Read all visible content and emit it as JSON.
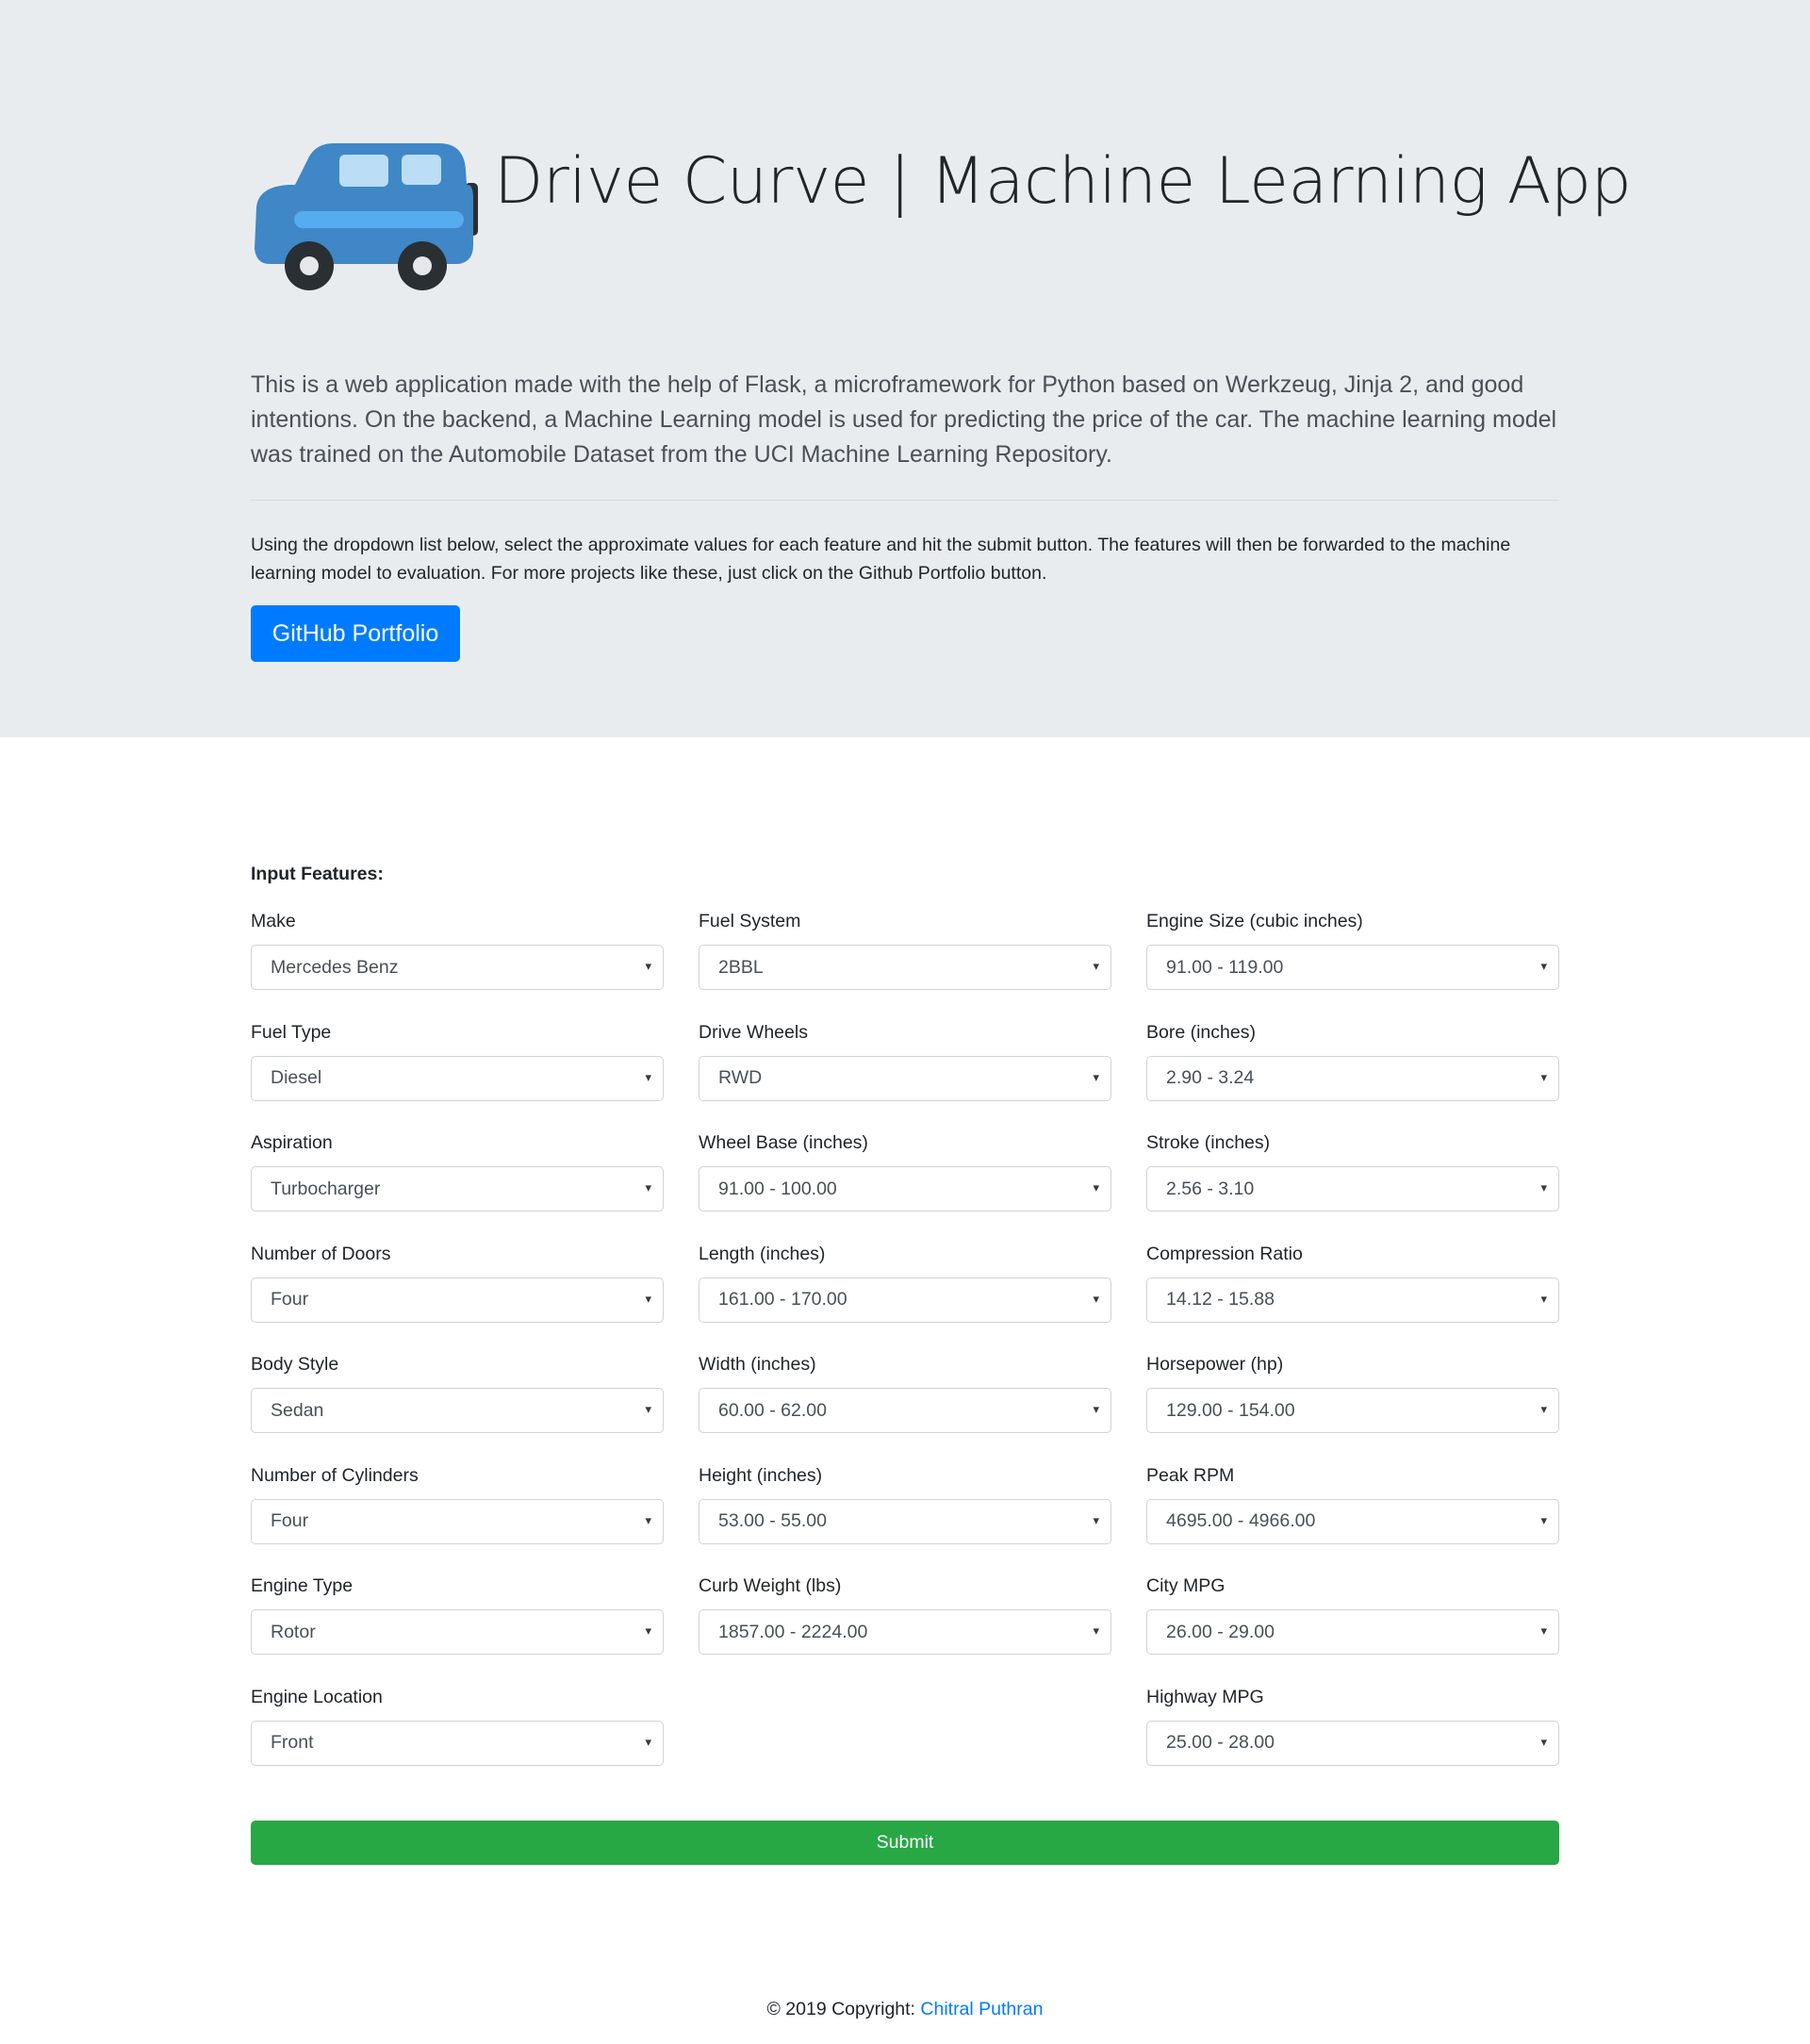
{
  "header": {
    "title": "Drive Curve | Machine Learning App",
    "logo_icon": "car-icon",
    "lead": "This is a web application made with the help of Flask, a microframework for Python based on Werkzeug, Jinja 2, and good intentions. On the backend, a Machine Learning model is used for predicting the price of the car. The machine learning model was trained on the Automobile Dataset from the UCI Machine Learning Repository.",
    "intro": "Using the dropdown list below, select the approximate values for each feature and hit the submit button. The features will then be forwarded to the machine learning model to evaluation. For more projects like these, just click on the Github Portfolio button.",
    "github_button": "GitHub Portfolio"
  },
  "form": {
    "heading": "Input Features:",
    "columns": [
      [
        {
          "label": "Make",
          "value": "Mercedes Benz"
        },
        {
          "label": "Fuel Type",
          "value": "Diesel"
        },
        {
          "label": "Aspiration",
          "value": "Turbocharger"
        },
        {
          "label": "Number of Doors",
          "value": "Four"
        },
        {
          "label": "Body Style",
          "value": "Sedan"
        },
        {
          "label": "Number of Cylinders",
          "value": "Four"
        },
        {
          "label": "Engine Type",
          "value": "Rotor"
        },
        {
          "label": "Engine Location",
          "value": "Front"
        }
      ],
      [
        {
          "label": "Fuel System",
          "value": "2BBL"
        },
        {
          "label": "Drive Wheels",
          "value": "RWD"
        },
        {
          "label": "Wheel Base (inches)",
          "value": "91.00 - 100.00"
        },
        {
          "label": "Length (inches)",
          "value": "161.00 - 170.00"
        },
        {
          "label": "Width (inches)",
          "value": "60.00 - 62.00"
        },
        {
          "label": "Height (inches)",
          "value": "53.00 - 55.00"
        },
        {
          "label": "Curb Weight (lbs)",
          "value": "1857.00 - 2224.00"
        }
      ],
      [
        {
          "label": "Engine Size (cubic inches)",
          "value": "91.00 - 119.00"
        },
        {
          "label": "Bore (inches)",
          "value": "2.90 - 3.24"
        },
        {
          "label": "Stroke (inches)",
          "value": "2.56 - 3.10"
        },
        {
          "label": "Compression Ratio",
          "value": "14.12 - 15.88"
        },
        {
          "label": "Horsepower (hp)",
          "value": "129.00 - 154.00"
        },
        {
          "label": "Peak RPM",
          "value": "4695.00 - 4966.00"
        },
        {
          "label": "City MPG",
          "value": "26.00 - 29.00"
        },
        {
          "label": "Highway MPG",
          "value": "25.00 - 28.00"
        }
      ]
    ],
    "caret_icon": "chevron-down-icon",
    "submit_label": "Submit"
  },
  "footer": {
    "copyright": "© 2019 Copyright: ",
    "author": "Chitral Puthran"
  },
  "colors": {
    "jumbotron_bg": "#e9ecef",
    "primary": "#007bff",
    "success": "#28a745",
    "car_body": "#3f87c6"
  }
}
